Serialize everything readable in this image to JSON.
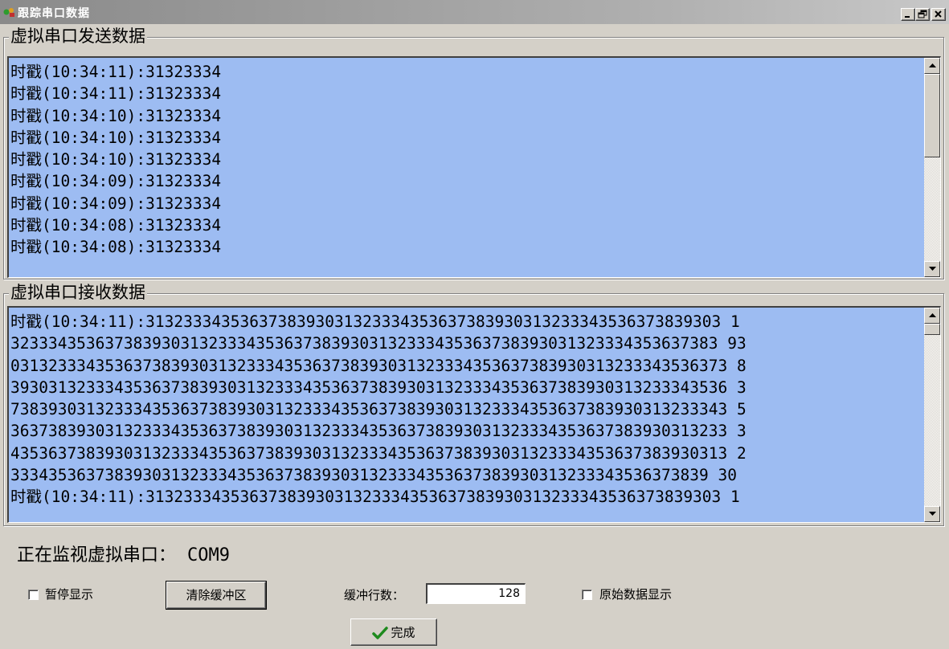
{
  "window": {
    "title": "跟踪串口数据",
    "controls": {
      "minimize": "_",
      "maximize": "□",
      "close": "×"
    }
  },
  "send_group": {
    "label": "虚拟串口发送数据",
    "lines": [
      "时戳(10:34:11):31323334",
      "时戳(10:34:11):31323334",
      "时戳(10:34:10):31323334",
      "时戳(10:34:10):31323334",
      "时戳(10:34:10):31323334",
      "时戳(10:34:09):31323334",
      "时戳(10:34:09):31323334",
      "时戳(10:34:08):31323334",
      "时戳(10:34:08):31323334"
    ]
  },
  "receive_group": {
    "label": "虚拟串口接收数据",
    "lines": [
      "时戳(10:34:11):3132333435363738393031323334353637383930313233343536373839303 1",
      "323334353637383930313233343536373839303132333435363738393031323334353637383 93",
      "0313233343536373839303132333435363738393031323334353637383930313233343536373 8",
      "3930313233343536373839303132333435363738393031323334353637383930313233343536 3",
      "7383930313233343536373839303132333435363738393031323334353637383930313233343 5",
      "3637383930313233343536373839303132333435363738393031323334353637383930313233 3",
      "4353637383930313233343536373839303132333435363738393031323334353637383930313 2",
      "33343536373839303132333435363738393031323334353637383930313233343536373839 30",
      "时戳(10:34:11):3132333435363738393031323334353637383930313233343536373839303 1"
    ]
  },
  "status": {
    "label": "正在监视虚拟串口：",
    "port": "COM9"
  },
  "controls": {
    "pause_label": "暂停显示",
    "pause_checked": false,
    "clear_button": "清除缓冲区",
    "buffer_label": "缓冲行数：",
    "buffer_value": "128",
    "raw_label": "原始数据显示",
    "raw_checked": false,
    "done_button": "完成"
  },
  "colors": {
    "text_bg": "#9dbcf2",
    "face": "#d4d0c8",
    "check_green": "#1e8a1e"
  },
  "icons": [
    "app-icon",
    "minimize-icon",
    "maximize-icon",
    "close-icon",
    "scroll-up-icon",
    "scroll-down-icon",
    "checkmark-icon"
  ]
}
